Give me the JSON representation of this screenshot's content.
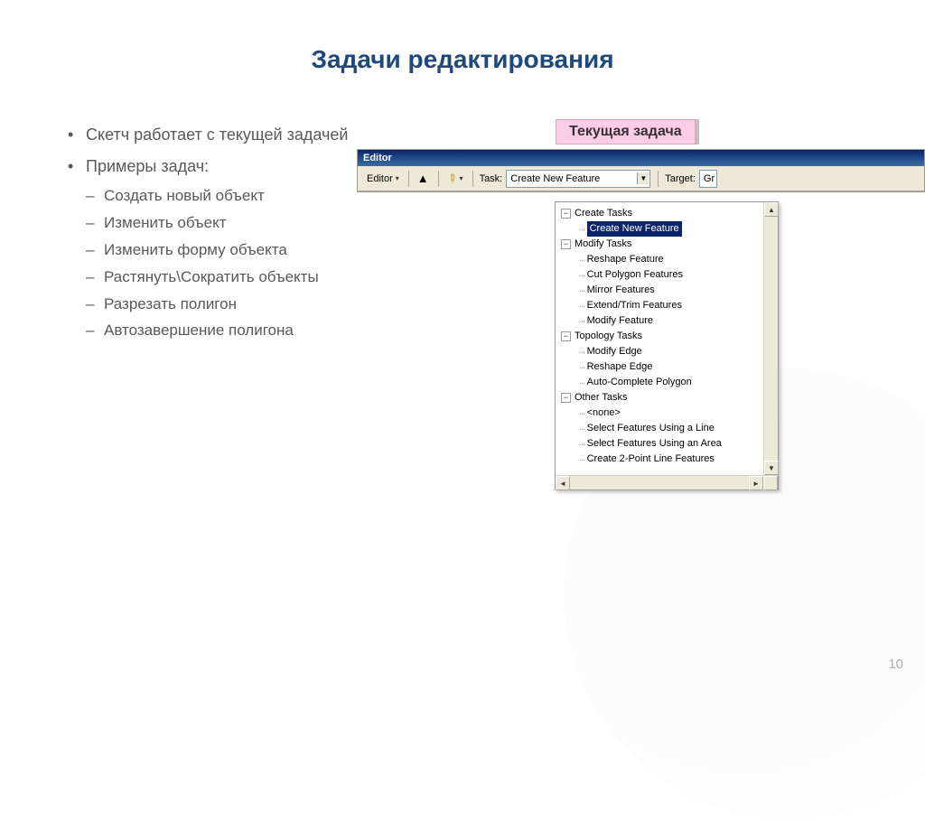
{
  "title": "Задачи редактирования",
  "bullets": {
    "item1": "Скетч работает с текущей задачей",
    "item2": "Примеры задач:",
    "sub1": "Создать новый объект",
    "sub2": "Изменить объект",
    "sub3": "Изменить форму объекта",
    "sub4": "Растянуть\\Сократить объекты",
    "sub5": "Разрезать полигон",
    "sub6": "Автозавершение полигона"
  },
  "callout": "Текущая задача",
  "editor": {
    "title": "Editor",
    "button": "Editor",
    "task_label": "Task:",
    "task_value": "Create New Feature",
    "target_label": "Target:",
    "target_value": "Gr"
  },
  "tree": {
    "g1": "Create Tasks",
    "g1_i1": "Create New Feature",
    "g2": "Modify Tasks",
    "g2_i1": "Reshape Feature",
    "g2_i2": "Cut Polygon Features",
    "g2_i3": "Mirror Features",
    "g2_i4": "Extend/Trim Features",
    "g2_i5": "Modify Feature",
    "g3": "Topology Tasks",
    "g3_i1": "Modify Edge",
    "g3_i2": "Reshape Edge",
    "g3_i3": "Auto-Complete Polygon",
    "g4": "Other Tasks",
    "g4_i1": "<none>",
    "g4_i2": "Select Features Using a Line",
    "g4_i3": "Select Features Using an Area",
    "g4_i4": "Create 2-Point Line Features"
  },
  "page_number": "10"
}
